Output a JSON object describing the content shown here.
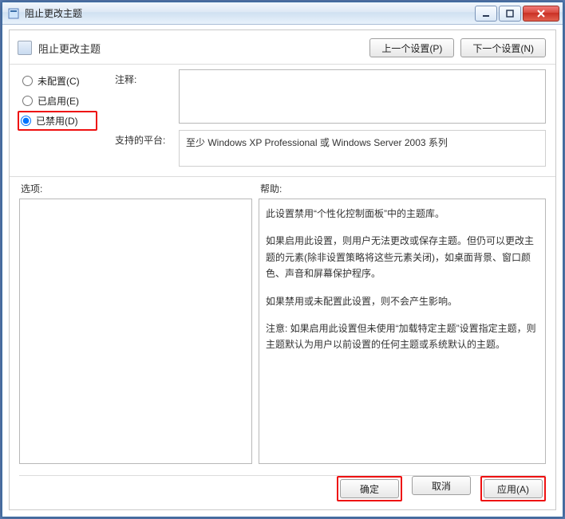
{
  "window": {
    "title": "阻止更改主题"
  },
  "header": {
    "policy_title": "阻止更改主题",
    "prev_button": "上一个设置(P)",
    "next_button": "下一个设置(N)"
  },
  "radios": {
    "not_configured": "未配置(C)",
    "enabled": "已启用(E)",
    "disabled": "已禁用(D)",
    "selected": "disabled"
  },
  "fields": {
    "comment_label": "注释:",
    "comment_value": "",
    "platform_label": "支持的平台:",
    "platform_value": "至少 Windows XP Professional 或 Windows Server 2003 系列"
  },
  "middle": {
    "options_label": "选项:",
    "help_label": "帮助:"
  },
  "help": {
    "p1": "此设置禁用“个性化控制面板”中的主题库。",
    "p2": "如果启用此设置，则用户无法更改或保存主题。但仍可以更改主题的元素(除非设置策略将这些元素关闭)，如桌面背景、窗口颜色、声音和屏幕保护程序。",
    "p3": "如果禁用或未配置此设置，则不会产生影响。",
    "p4": "注意: 如果启用此设置但未使用“加载特定主题”设置指定主题，则主题默认为用户以前设置的任何主题或系统默认的主题。"
  },
  "footer": {
    "ok": "确定",
    "cancel": "取消",
    "apply": "应用(A)"
  }
}
